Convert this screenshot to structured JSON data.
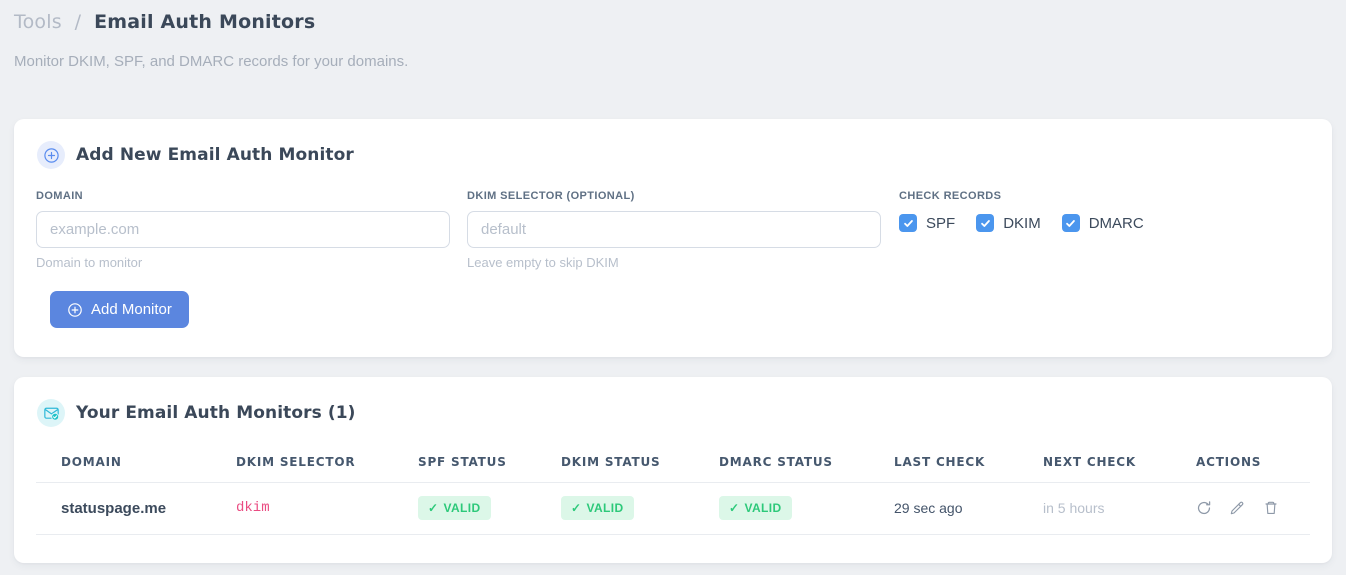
{
  "breadcrumb": {
    "section": "Tools",
    "separator": "/",
    "page": "Email Auth Monitors"
  },
  "subtitle": "Monitor DKIM, SPF, and DMARC records for your domains.",
  "glyphs": {
    "check": "✓"
  },
  "colors": {
    "accent_blue": "#5b86df",
    "checkbox_blue": "#4b96ee",
    "badge_green_text": "#2dc97a",
    "badge_green_bg": "#dcf7e8",
    "selector_pink": "#ea4c82",
    "envelope_teal": "#2fb9d8"
  },
  "add_card": {
    "title": "Add New Email Auth Monitor",
    "fields": {
      "domain": {
        "label": "DOMAIN",
        "placeholder": "example.com",
        "value": "",
        "hint": "Domain to monitor"
      },
      "dkim_selector": {
        "label": "DKIM SELECTOR (OPTIONAL)",
        "placeholder": "default",
        "value": "",
        "hint": "Leave empty to skip DKIM"
      }
    },
    "check_records": {
      "label": "CHECK RECORDS",
      "options": [
        {
          "label": "SPF",
          "checked": true
        },
        {
          "label": "DKIM",
          "checked": true
        },
        {
          "label": "DMARC",
          "checked": true
        }
      ]
    },
    "submit_label": "Add Monitor"
  },
  "monitors_card": {
    "title": "Your Email Auth Monitors (1)",
    "table": {
      "headers": [
        "DOMAIN",
        "DKIM SELECTOR",
        "SPF STATUS",
        "DKIM STATUS",
        "DMARC STATUS",
        "LAST CHECK",
        "NEXT CHECK",
        "ACTIONS"
      ],
      "rows": [
        {
          "domain": "statuspage.me",
          "dkim_selector": "dkim",
          "spf_status": "VALID",
          "dkim_status": "VALID",
          "dmarc_status": "VALID",
          "last_check": "29 sec ago",
          "next_check": "in 5 hours"
        }
      ]
    }
  }
}
